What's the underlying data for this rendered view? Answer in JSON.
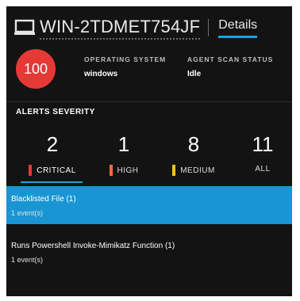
{
  "header": {
    "hostname": "WIN-2TDMET754JF",
    "details_tab": "Details"
  },
  "risk": {
    "score": "100",
    "color": "#e53935"
  },
  "meta": {
    "os_label": "OPERATING SYSTEM",
    "os_value": "windows",
    "scan_label": "AGENT SCAN STATUS",
    "scan_value": "Idle"
  },
  "alerts_severity": {
    "title": "ALERTS SEVERITY",
    "items": [
      {
        "count": "2",
        "label": "CRITICAL",
        "color": "#e53935"
      },
      {
        "count": "1",
        "label": "HIGH",
        "color": "#ef6c3a"
      },
      {
        "count": "8",
        "label": "MEDIUM",
        "color": "#f6c21a"
      },
      {
        "count": "11",
        "label": "ALL"
      }
    ]
  },
  "alerts": [
    {
      "title": "Blacklisted File (1)",
      "sub": "1 event(s)"
    },
    {
      "title": "Runs Powershell Invoke-Mimikatz Function (1)",
      "sub": "1 event(s)"
    }
  ],
  "colors": {
    "accent": "#1ba1e2",
    "selected_row": "#1a95d4",
    "panel_bg": "#131313"
  }
}
